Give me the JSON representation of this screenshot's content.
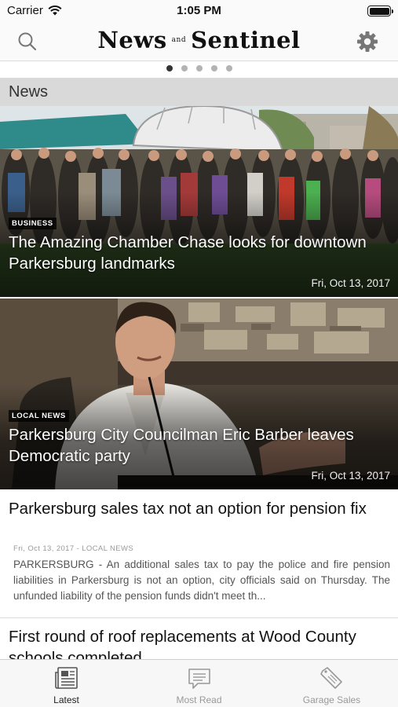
{
  "status_bar": {
    "carrier": "Carrier",
    "time": "1:05 PM"
  },
  "nav": {
    "masthead_left": "News",
    "masthead_and": "and",
    "masthead_right": "Sentinel"
  },
  "section": {
    "title": "News"
  },
  "pager": {
    "count": 5,
    "active_index": 0
  },
  "hero_stories": [
    {
      "category": "BUSINESS",
      "headline": "The Amazing Chamber Chase looks for downtown Parkersburg landmarks",
      "date": "Fri, Oct 13, 2017"
    },
    {
      "category": "LOCAL NEWS",
      "headline": "Parkersburg City Councilman Eric Barber leaves Democratic party",
      "date": "Fri, Oct 13, 2017"
    }
  ],
  "articles": [
    {
      "headline": "Parkersburg sales tax not an option for pension fix",
      "meta": "Fri, Oct 13, 2017 - LOCAL NEWS",
      "excerpt": "PARKERSBURG - An additional sales tax to pay the police and fire pension liabilities in Parkersburg is not an option, city officials said on Thursday. The unfunded liability of the pension funds didn't meet th..."
    },
    {
      "headline": "First round of roof replacements at Wood County schools completed"
    }
  ],
  "tabs": [
    {
      "label": "Latest",
      "icon": "newspaper-icon",
      "active": true
    },
    {
      "label": "Most Read",
      "icon": "speech-bubble-icon",
      "active": false
    },
    {
      "label": "Garage Sales",
      "icon": "price-tag-icon",
      "active": false
    }
  ],
  "colors": {
    "section_header_bg": "#d9d9d9",
    "tab_active": "#222222",
    "tab_inactive": "#999999"
  }
}
